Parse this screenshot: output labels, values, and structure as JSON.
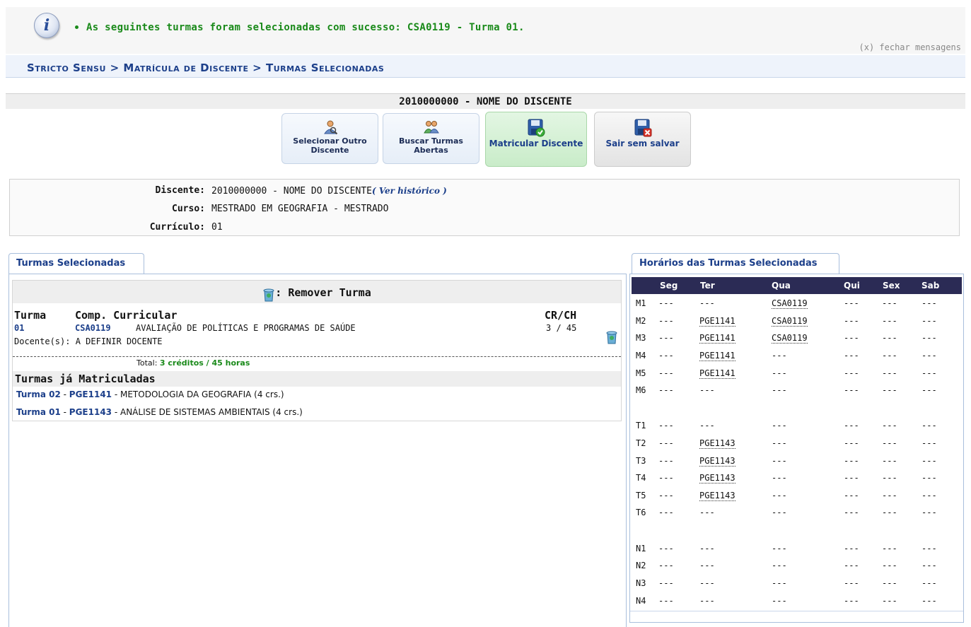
{
  "message": {
    "text": "As seguintes turmas foram selecionadas com sucesso: CSA0119 - Turma 01.",
    "close_label": "(x) fechar mensagens"
  },
  "breadcrumb": "Stricto Sensu > Matrícula de Discente > Turmas Selecionadas",
  "student_header": "2010000000 - NOME DO DISCENTE",
  "actions": {
    "select_other": "Selecionar Outro Discente",
    "search_open": "Buscar Turmas Abertas",
    "enroll": "Matricular Discente",
    "exit": "Sair sem salvar"
  },
  "info": {
    "discente_label": "Discente:",
    "discente_value": "2010000000 - NOME DO DISCENTE",
    "historico_link": "( Ver histórico )",
    "curso_label": "Curso:",
    "curso_value": "MESTRADO EM GEOGRAFIA - MESTRADO",
    "curriculo_label": "Currículo:",
    "curriculo_value": "01"
  },
  "tabs": {
    "selected": "Turmas Selecionadas",
    "schedule": "Horários das Turmas Selecionadas"
  },
  "selected": {
    "remove_header": ": Remover Turma",
    "col_turma": "Turma",
    "col_comp": "Comp. Curricular",
    "col_crch": "CR/CH",
    "row": {
      "turma": "01",
      "code": "CSA0119",
      "name": "AVALIAÇÃO DE POLÍTICAS E PROGRAMAS DE SAÚDE",
      "crch": "3 / 45",
      "docente": "Docente(s): A DEFINIR DOCENTE"
    },
    "total_label": "Total:",
    "total_value": "3 créditos / 45 horas",
    "enrolled_header": "Turmas já Matriculadas",
    "enrolled": [
      {
        "turma": "Turma 02",
        "code": "PGE1141",
        "name": "METODOLOGIA DA GEOGRAFIA (4 crs.)"
      },
      {
        "turma": "Turma 01",
        "code": "PGE1143",
        "name": "ANÁLISE DE SISTEMAS AMBIENTAIS (4 crs.)"
      }
    ]
  },
  "schedule": {
    "days": [
      "Seg",
      "Ter",
      "Qua",
      "Qui",
      "Sex",
      "Sab"
    ],
    "rows": [
      {
        "slot": "M1",
        "cells": [
          "---",
          "---",
          "CSA0119",
          "---",
          "---",
          "---"
        ]
      },
      {
        "slot": "M2",
        "cells": [
          "---",
          "PGE1141",
          "CSA0119",
          "---",
          "---",
          "---"
        ]
      },
      {
        "slot": "M3",
        "cells": [
          "---",
          "PGE1141",
          "CSA0119",
          "---",
          "---",
          "---"
        ]
      },
      {
        "slot": "M4",
        "cells": [
          "---",
          "PGE1141",
          "---",
          "---",
          "---",
          "---"
        ]
      },
      {
        "slot": "M5",
        "cells": [
          "---",
          "PGE1141",
          "---",
          "---",
          "---",
          "---"
        ]
      },
      {
        "slot": "M6",
        "cells": [
          "---",
          "---",
          "---",
          "---",
          "---",
          "---"
        ]
      },
      {
        "slot": "T1",
        "cells": [
          "---",
          "---",
          "---",
          "---",
          "---",
          "---"
        ]
      },
      {
        "slot": "T2",
        "cells": [
          "---",
          "PGE1143",
          "---",
          "---",
          "---",
          "---"
        ]
      },
      {
        "slot": "T3",
        "cells": [
          "---",
          "PGE1143",
          "---",
          "---",
          "---",
          "---"
        ]
      },
      {
        "slot": "T4",
        "cells": [
          "---",
          "PGE1143",
          "---",
          "---",
          "---",
          "---"
        ]
      },
      {
        "slot": "T5",
        "cells": [
          "---",
          "PGE1143",
          "---",
          "---",
          "---",
          "---"
        ]
      },
      {
        "slot": "T6",
        "cells": [
          "---",
          "---",
          "---",
          "---",
          "---",
          "---"
        ]
      },
      {
        "slot": "N1",
        "cells": [
          "---",
          "---",
          "---",
          "---",
          "---",
          "---"
        ]
      },
      {
        "slot": "N2",
        "cells": [
          "---",
          "---",
          "---",
          "---",
          "---",
          "---"
        ]
      },
      {
        "slot": "N3",
        "cells": [
          "---",
          "---",
          "---",
          "---",
          "---",
          "---"
        ]
      },
      {
        "slot": "N4",
        "cells": [
          "---",
          "---",
          "---",
          "---",
          "---",
          "---"
        ]
      }
    ]
  }
}
